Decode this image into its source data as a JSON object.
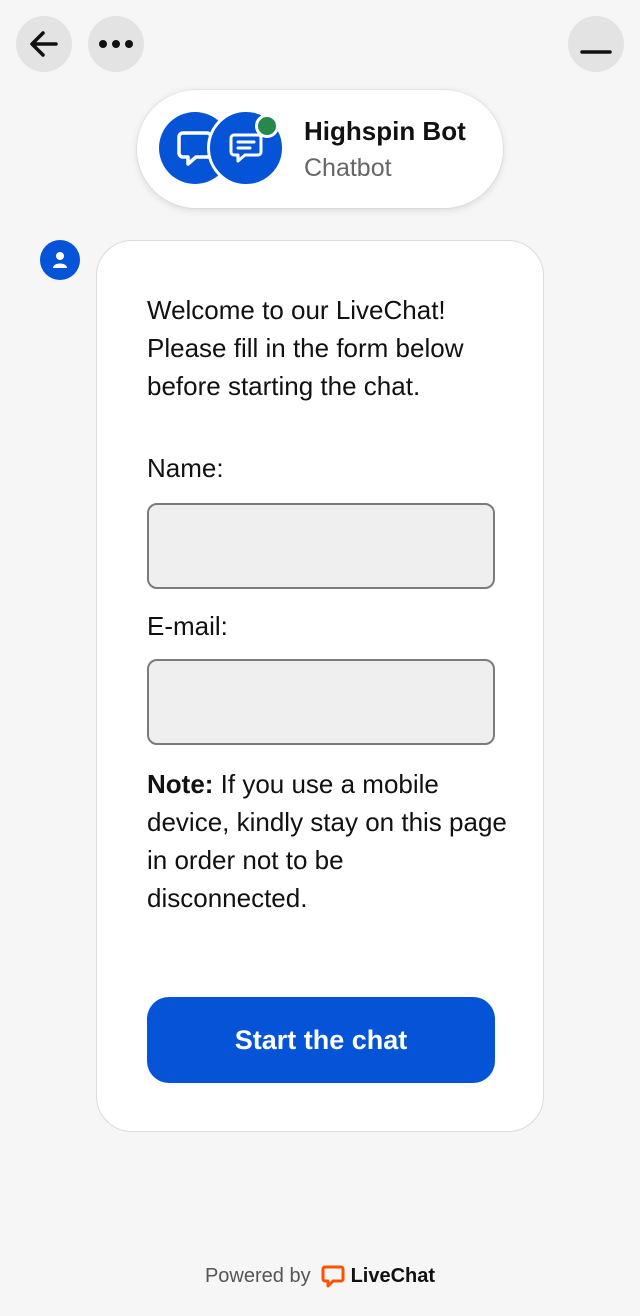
{
  "colors": {
    "accent": "#0554d8",
    "online": "#24894a",
    "background": "#f6f6f6",
    "livechat_logo": "#ff5100"
  },
  "top_bar": {
    "back_icon": "arrow-left-icon",
    "more_icon": "ellipsis-icon",
    "minimize_icon": "minimize-icon"
  },
  "header": {
    "bot_name": "Highspin Bot",
    "bot_role": "Chatbot",
    "status": "online"
  },
  "form": {
    "welcome": "Welcome to our LiveChat! Please fill in the form below before starting the chat.",
    "name_label": "Name:",
    "name_value": "",
    "email_label": "E-mail:",
    "email_value": "",
    "note_bold": "Note:",
    "note_text": " If you use a mobile device, kindly stay on this page in order not to be disconnected.",
    "submit_label": "Start the chat"
  },
  "footer": {
    "powered_by": "Powered by",
    "brand": "LiveChat"
  }
}
